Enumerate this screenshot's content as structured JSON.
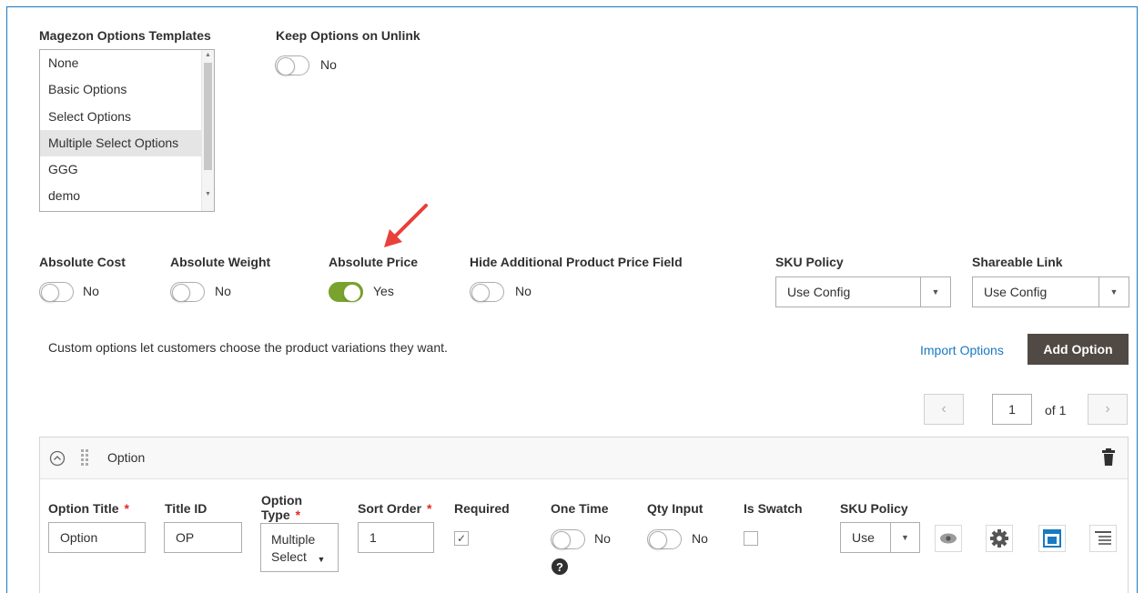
{
  "templates": {
    "label": "Magezon Options Templates",
    "options": [
      "None",
      "Basic Options",
      "Select Options",
      "Multiple Select Options",
      "GGG",
      "demo"
    ],
    "selected_index": 3
  },
  "keep_options": {
    "label": "Keep Options on Unlink",
    "value": "No",
    "on": false
  },
  "absolute_cost": {
    "label": "Absolute Cost",
    "value": "No",
    "on": false
  },
  "absolute_weight": {
    "label": "Absolute Weight",
    "value": "No",
    "on": false
  },
  "absolute_price": {
    "label": "Absolute Price",
    "value": "Yes",
    "on": true
  },
  "hide_price_field": {
    "label": "Hide Additional Product Price Field",
    "value": "No",
    "on": false
  },
  "sku_policy": {
    "label": "SKU Policy",
    "value": "Use Config"
  },
  "shareable_link": {
    "label": "Shareable Link",
    "value": "Use Config"
  },
  "description": "Custom options let customers choose the product variations they want.",
  "import_options": "Import Options",
  "add_option": "Add Option",
  "pager": {
    "current": "1",
    "of_label": "of 1"
  },
  "option": {
    "header_title": "Option",
    "fields": {
      "option_title_label": "Option Title",
      "option_title_value": "Option",
      "title_id_label": "Title ID",
      "title_id_value": "OP",
      "option_type_label_1": "Option",
      "option_type_label_2": "Type",
      "option_type_value_1": "Multiple",
      "option_type_value_2": "Select",
      "sort_order_label": "Sort Order",
      "sort_order_value": "1",
      "required_label": "Required",
      "required_checked": true,
      "one_time_label": "One Time",
      "one_time_value": "No",
      "qty_input_label": "Qty Input",
      "qty_input_value": "No",
      "is_swatch_label": "Is Swatch",
      "sku_policy_label": "SKU Policy",
      "sku_policy_value": "Use"
    }
  },
  "colors": {
    "accent": "#1979c3",
    "toggle_on": "#79a22e",
    "button_dark": "#514943",
    "required": "#e02b27",
    "arrow": "#e8403a"
  }
}
